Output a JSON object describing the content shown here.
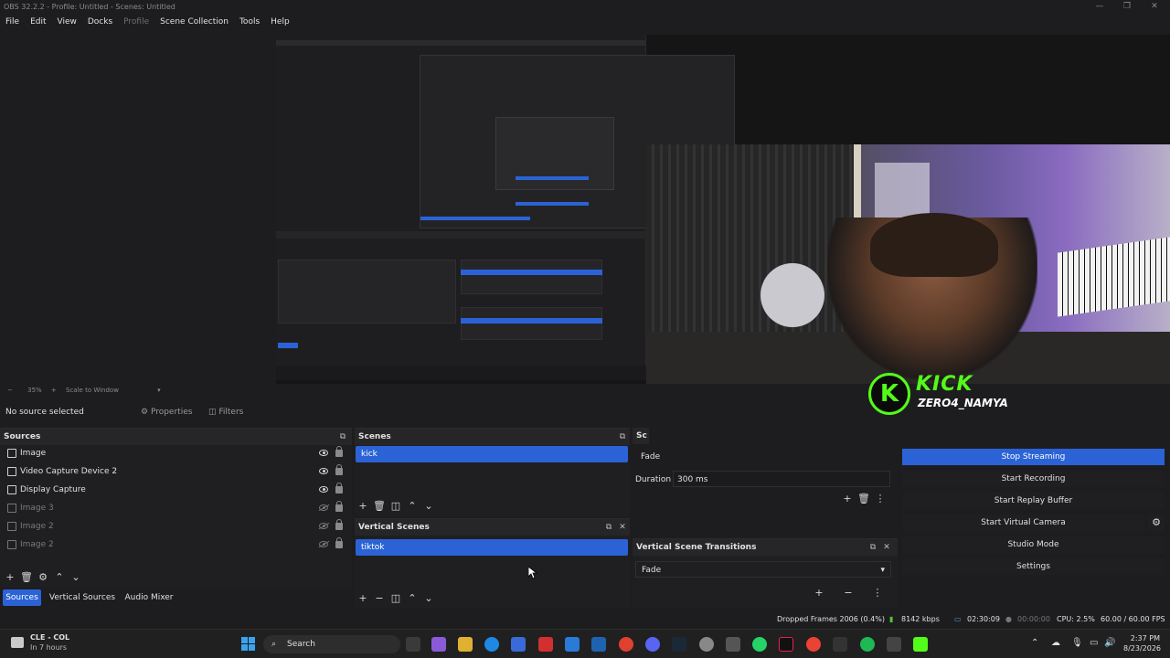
{
  "window": {
    "title": "OBS 32.2.2 - Profile: Untitled - Scenes: Untitled",
    "minimize": "—",
    "maximize": "❐",
    "close": "✕"
  },
  "menu": [
    "File",
    "Edit",
    "View",
    "Docks",
    "Profile",
    "Scene Collection",
    "Tools",
    "Help"
  ],
  "preview": {
    "zoom": "35%",
    "scale_mode": "Scale to Window",
    "overlay_name": "ZERO4_NAMYA",
    "overlay_brand": "KICK",
    "overlay_letter": "K"
  },
  "source_bar": {
    "status": "No source selected",
    "properties": "Properties",
    "filters": "Filters"
  },
  "sources": {
    "title": "Sources",
    "items": [
      {
        "label": "Image",
        "visible": true,
        "icon": "image-icon"
      },
      {
        "label": "Video Capture Device 2",
        "visible": true,
        "icon": "camera-icon"
      },
      {
        "label": "Display Capture",
        "visible": true,
        "icon": "monitor-icon"
      },
      {
        "label": "Image 3",
        "visible": false,
        "icon": "image-icon"
      },
      {
        "label": "Image 2",
        "visible": false,
        "icon": "image-icon"
      },
      {
        "label": "Image 2",
        "visible": false,
        "icon": "image-icon"
      }
    ]
  },
  "tabs": [
    "Sources",
    "Vertical Sources",
    "Audio Mixer"
  ],
  "scenes": {
    "title": "Scenes",
    "items": [
      "kick"
    ]
  },
  "vertical_scenes": {
    "title": "Vertical Scenes",
    "items": [
      "tiktok"
    ]
  },
  "transitions": {
    "title": "Sc",
    "selected": "Fade",
    "duration_label": "Duration",
    "duration_value": "300 ms"
  },
  "vertical_transitions": {
    "title": "Vertical Scene Transitions",
    "selected": "Fade"
  },
  "controls": {
    "stop_streaming": "Stop Streaming",
    "start_recording": "Start Recording",
    "start_replay": "Start Replay Buffer",
    "start_virtual_camera": "Start Virtual Camera",
    "studio_mode": "Studio Mode",
    "settings": "Settings"
  },
  "status": {
    "dropped_frames": "Dropped Frames 2006 (0.4%)",
    "bitrate": "8142 kbps",
    "stream_time": "02:30:09",
    "rec_time": "00:00:00",
    "cpu": "CPU: 2.5%",
    "fps": "60.00 / 60.00 FPS"
  },
  "taskbar": {
    "weather_title": "CLE - COL",
    "weather_sub": "In 7 hours",
    "search": "Search",
    "time": "2:37 PM",
    "date": "8/23/2026"
  },
  "colors": {
    "accent": "#2b63d6",
    "kick_green": "#53fc18",
    "panel_bg": "#1f1f22"
  }
}
